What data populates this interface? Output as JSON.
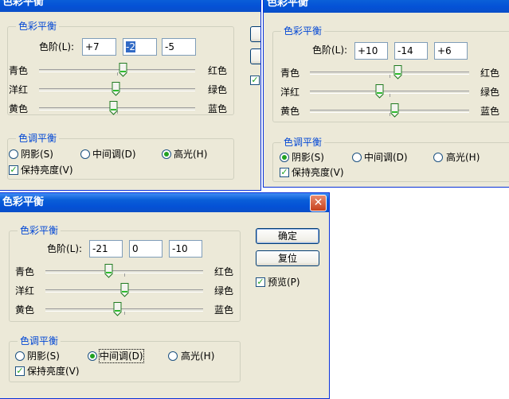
{
  "windows": {
    "w1": {
      "title": "色彩平衡",
      "group_color": "色彩平衡",
      "levels_label": "色阶(L):",
      "levels": [
        "+7",
        "-2",
        "-5"
      ],
      "sliders": [
        {
          "left": "青色",
          "right": "红色",
          "value": 7
        },
        {
          "left": "洋红",
          "right": "绿色",
          "value": -2
        },
        {
          "left": "黄色",
          "right": "蓝色",
          "value": -5
        }
      ],
      "group_tone": "色调平衡",
      "tones": [
        "阴影(S)",
        "中间调(D)",
        "高光(H)"
      ],
      "selected_tone": "高光(H)",
      "preserve": "保持亮度(V)",
      "preserve_checked": true
    },
    "w2": {
      "title": "色彩平衡",
      "group_color": "色彩平衡",
      "levels_label": "色阶(L):",
      "levels": [
        "+10",
        "-14",
        "+6"
      ],
      "sliders": [
        {
          "left": "青色",
          "right": "红色",
          "value": 10
        },
        {
          "left": "洋红",
          "right": "绿色",
          "value": -14
        },
        {
          "left": "黄色",
          "right": "蓝色",
          "value": 6
        }
      ],
      "group_tone": "色调平衡",
      "tones": [
        "阴影(S)",
        "中间调(D)",
        "高光(H)"
      ],
      "selected_tone": "阴影(S)",
      "preserve": "保持亮度(V)",
      "preserve_checked": true
    },
    "w3": {
      "title": "色彩平衡",
      "group_color": "色彩平衡",
      "levels_label": "色阶(L):",
      "levels": [
        "-21",
        "0",
        "-10"
      ],
      "sliders": [
        {
          "left": "青色",
          "right": "红色",
          "value": -21
        },
        {
          "left": "洋红",
          "right": "绿色",
          "value": 0
        },
        {
          "left": "黄色",
          "right": "蓝色",
          "value": -10
        }
      ],
      "group_tone": "色调平衡",
      "tones": [
        "阴影(S)",
        "中间调(D)",
        "高光(H)"
      ],
      "selected_tone": "中间调(D)",
      "preserve": "保持亮度(V)",
      "preserve_checked": true,
      "ok": "确定",
      "reset": "复位",
      "preview": "预览(P)",
      "preview_checked": true,
      "close_glyph": "✕"
    }
  },
  "colors": {
    "accent": "#0046d5",
    "titlebar": "#0a5fd8",
    "dialog_bg": "#ece9d8",
    "check": "#21a121"
  }
}
